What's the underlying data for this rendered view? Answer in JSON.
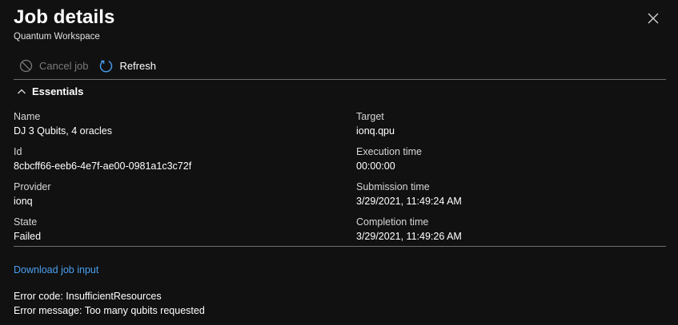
{
  "header": {
    "title": "Job details",
    "subtitle": "Quantum Workspace"
  },
  "toolbar": {
    "cancel_label": "Cancel job",
    "refresh_label": "Refresh"
  },
  "essentials": {
    "header_label": "Essentials",
    "fields": {
      "name": {
        "label": "Name",
        "value": "DJ 3 Qubits, 4 oracles"
      },
      "id": {
        "label": "Id",
        "value": "8cbcff66-eeb6-4e7f-ae00-0981a1c3c72f"
      },
      "provider": {
        "label": "Provider",
        "value": "ionq"
      },
      "state": {
        "label": "State",
        "value": "Failed"
      },
      "target": {
        "label": "Target",
        "value": "ionq.qpu"
      },
      "execution_time": {
        "label": "Execution time",
        "value": "00:00:00"
      },
      "submission_time": {
        "label": "Submission time",
        "value": "3/29/2021, 11:49:24 AM"
      },
      "completion_time": {
        "label": "Completion time",
        "value": "3/29/2021, 11:49:26 AM"
      }
    }
  },
  "download_link": "Download job input",
  "error": {
    "code_line": "Error code: InsufficientResources",
    "message_line": "Error message: Too many qubits requested"
  },
  "colors": {
    "background": "#111111",
    "link": "#4aa0f0",
    "refresh_icon": "#4aa0f0",
    "disabled_text": "#7a7a7a"
  },
  "icons": {
    "close": "close-icon",
    "cancel": "cancel-icon",
    "refresh": "refresh-icon",
    "collapse": "chevron-up-icon"
  }
}
